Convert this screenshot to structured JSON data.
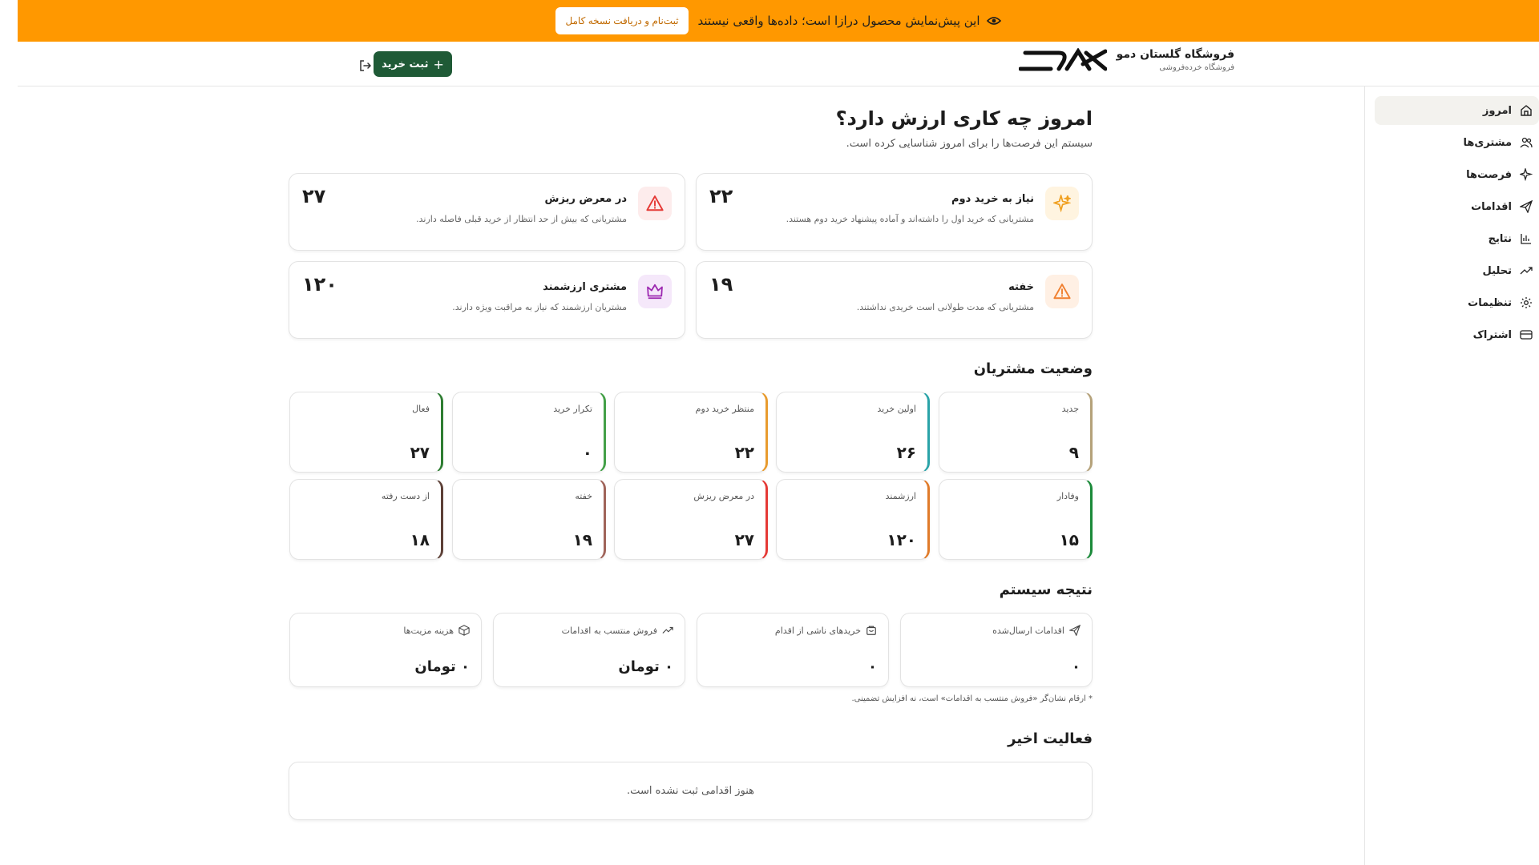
{
  "banner": {
    "text": "این پیش‌نمایش محصول درازا است؛ داده‌ها واقعی نیستند",
    "cta": "ثبت‌نام و دریافت نسخه کامل"
  },
  "header": {
    "store_name": "فروشگاه گلستان دمو",
    "store_type": "فروشگاه خرده‌فروشی",
    "add_purchase": "ثبت خرید"
  },
  "sidebar": {
    "items": [
      {
        "label": "امروز",
        "icon": "home-icon"
      },
      {
        "label": "مشتری‌ها",
        "icon": "users-icon"
      },
      {
        "label": "فرصت‌ها",
        "icon": "sparkle-icon"
      },
      {
        "label": "اقدامات",
        "icon": "send-icon"
      },
      {
        "label": "نتایج",
        "icon": "bar-chart-icon"
      },
      {
        "label": "تحلیل",
        "icon": "trend-icon"
      },
      {
        "label": "تنظیمات",
        "icon": "gear-icon"
      },
      {
        "label": "اشتراک",
        "icon": "card-icon"
      }
    ]
  },
  "main": {
    "title": "امروز چه کاری ارزش دارد؟",
    "subtitle": "سیستم این فرصت‌ها را برای امروز شناسایی کرده است.",
    "opportunities": [
      {
        "title": "نیاز به خرید دوم",
        "desc": "مشتریانی که خرید اول را داشته‌اند و آماده پیشنهاد خرید دوم هستند.",
        "count": "۲۲",
        "icon": "sparkle-icon",
        "color": "#f0a020"
      },
      {
        "title": "در معرض ریزش",
        "desc": "مشتریانی که بیش از حد انتظار از خرید قبلی فاصله دارند.",
        "count": "۲۷",
        "icon": "alert-icon",
        "color": "#e53935"
      },
      {
        "title": "خفته",
        "desc": "مشتریانی که مدت طولانی است خریدی نداشتند.",
        "count": "۱۹",
        "icon": "alert-icon",
        "color": "#f08030"
      },
      {
        "title": "مشتری ارزشمند",
        "desc": "مشتریان ارزشمند که نیاز به مراقبت ویژه دارند.",
        "count": "۱۲۰",
        "icon": "crown-icon",
        "color": "#9c27b0"
      }
    ],
    "status_title": "وضعیت مشتریان",
    "status": [
      {
        "label": "جدید",
        "value": "۹",
        "color": "#b5a27a"
      },
      {
        "label": "اولین خرید",
        "value": "۲۶",
        "color": "#2aa3a8"
      },
      {
        "label": "منتظر خرید دوم",
        "value": "۲۲",
        "color": "#e89b2e"
      },
      {
        "label": "تکرار خرید",
        "value": "۰",
        "color": "#43a047"
      },
      {
        "label": "فعال",
        "value": "۲۷",
        "color": "#2e7d32"
      },
      {
        "label": "وفادار",
        "value": "۱۵",
        "color": "#1b8a3a"
      },
      {
        "label": "ارزشمند",
        "value": "۱۲۰",
        "color": "#e07b2a"
      },
      {
        "label": "در معرض ریزش",
        "value": "۲۷",
        "color": "#e53935"
      },
      {
        "label": "خفته",
        "value": "۱۹",
        "color": "#a0645a"
      },
      {
        "label": "از دست رفته",
        "value": "۱۸",
        "color": "#5d4037"
      }
    ],
    "result_title": "نتیجه سیستم",
    "results": [
      {
        "label": "اقدامات ارسال‌شده",
        "value": "۰",
        "icon": "send-icon"
      },
      {
        "label": "خریدهای ناشی از اقدام",
        "value": "۰",
        "icon": "bag-icon"
      },
      {
        "label": "فروش منتسب به اقدامات",
        "value": "۰ تومان",
        "icon": "trend-icon"
      },
      {
        "label": "هزینه مزیت‌ها",
        "value": "۰ تومان",
        "icon": "box-icon"
      }
    ],
    "footnote": "* ارقام نشان‌گر «فروش منتسب به اقدامات» است، نه افزایش تضمینی.",
    "activity_title": "فعالیت اخیر",
    "activity_empty": "هنوز اقدامی ثبت نشده است."
  }
}
